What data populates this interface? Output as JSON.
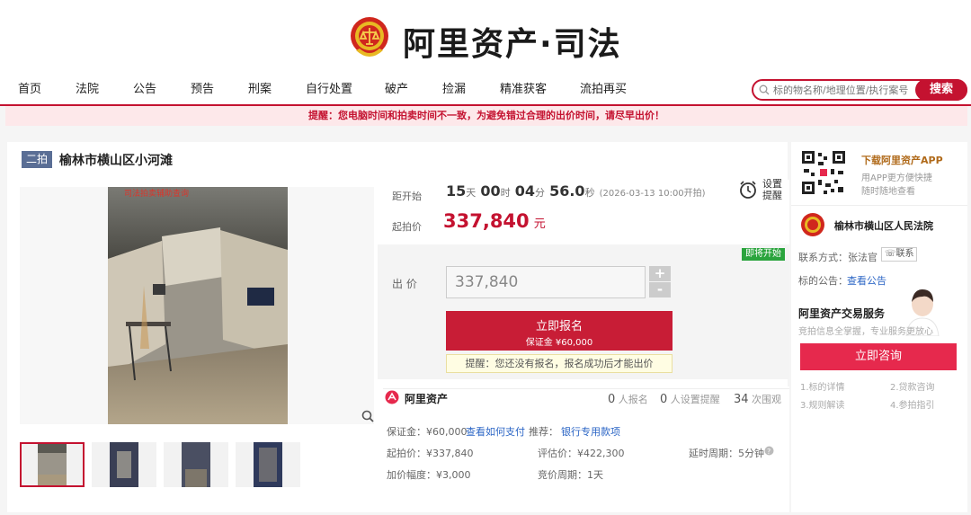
{
  "header": {
    "logo_text": "阿里资产·司法"
  },
  "nav": {
    "items": [
      "首页",
      "法院",
      "公告",
      "预告",
      "刑案",
      "自行处置",
      "破产",
      "捡漏",
      "精准获客",
      "流拍再买"
    ]
  },
  "search": {
    "placeholder": "标的物名称/地理位置/执行案号",
    "button": "搜索"
  },
  "notice": "提醒：您电脑时间和拍卖时间不一致，为避免错过合理的出价时间，请尽早出价！",
  "item": {
    "round": "二拍",
    "title": "榆林市横山区小河滩",
    "watermark": "司法拍卖辅助查询"
  },
  "countdown": {
    "label": "距开始",
    "days": "15",
    "days_unit": "天",
    "hours": "00",
    "hours_unit": "时",
    "minutes": "04",
    "minutes_unit": "分",
    "seconds": "56.0",
    "seconds_unit": "秒",
    "start_time": "(2026-03-13 10:00开拍)"
  },
  "alarm": {
    "label1": "设置",
    "label2": "提醒"
  },
  "start_price": {
    "label": "起拍价",
    "value": "337,840",
    "unit": "元"
  },
  "soon_badge": "即将开始",
  "bid": {
    "label": "出 价",
    "value": "337,840",
    "plus": "+",
    "minus": "-",
    "register_label": "立即报名",
    "deposit_label": "保证金 ¥60,000",
    "tip": "提醒：您还没有报名，报名成功后才能出价"
  },
  "stats": {
    "brand": "阿里资产",
    "signup_count": "0",
    "signup_label": "人报名",
    "remind_count": "0",
    "remind_label": "人设置提醒",
    "views_count": "34",
    "views_label": "次围观",
    "deposit_label": "保证金：¥60,000",
    "how_pay": "查看如何支付",
    "recommend_label": "推荐：",
    "bank_link": "银行专用款项",
    "start_price": "起拍价：¥337,840",
    "appraisal": "评估价：¥422,300",
    "delay": "延时周期：5分钟",
    "increment": "加价幅度：¥3,000",
    "period": "竞价周期：1天"
  },
  "sidebar": {
    "app_title": "下载阿里资产APP",
    "app_line1": "用APP更方便快捷",
    "app_line2": "随时随地查看",
    "court": "榆林市横山区人民法院",
    "contact_label": "联系方式：张法官",
    "contact_btn": "联系",
    "announcement_label": "标的公告：",
    "announcement_link": "查看公告",
    "service_title": "阿里资产交易服务",
    "service_sub": "竞拍信息全掌握，专业服务更放心",
    "consult_btn": "立即咨询",
    "links": [
      "1.标的详情",
      "2.贷款咨询",
      "3.规则解读",
      "4.参拍指引"
    ]
  },
  "colors": {
    "brand_red": "#c41230",
    "badge_blue": "#5a6e95",
    "green": "#2aa43d",
    "link_blue": "#2b65c5"
  }
}
